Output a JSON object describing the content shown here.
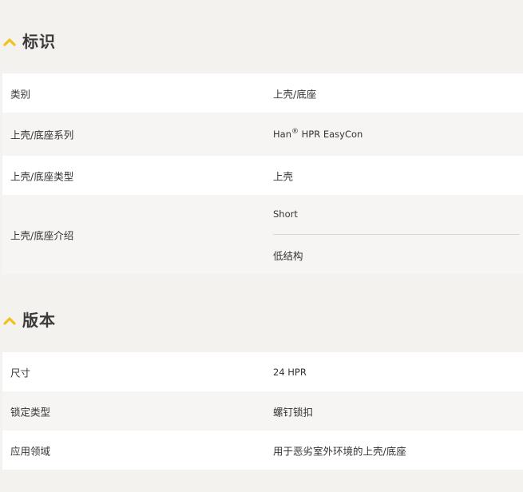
{
  "sections": [
    {
      "title": "标识",
      "rows": [
        {
          "label": "类别",
          "value": "上壳/底座"
        },
        {
          "label": "上壳/底座系列",
          "value": "Han",
          "value_sup": "®",
          "value_rest": " HPR EasyCon"
        },
        {
          "label": "上壳/底座类型",
          "value": "上壳"
        },
        {
          "label": "上壳/底座介绍",
          "values": [
            "Short",
            "低结构"
          ]
        }
      ]
    },
    {
      "title": "版本",
      "rows": [
        {
          "label": "尺寸",
          "value": "24 HPR"
        },
        {
          "label": "锁定类型",
          "value": "螺钉锁扣"
        },
        {
          "label": "应用领域",
          "value": "用于恶劣室外环境的上壳/底座"
        }
      ]
    }
  ],
  "colors": {
    "accent": "#f2c21b",
    "background": "#f4f2ef",
    "row_white": "#ffffff",
    "row_grey": "#f6f5f3"
  },
  "icons": {
    "section_toggle": "chevron-up-icon"
  }
}
